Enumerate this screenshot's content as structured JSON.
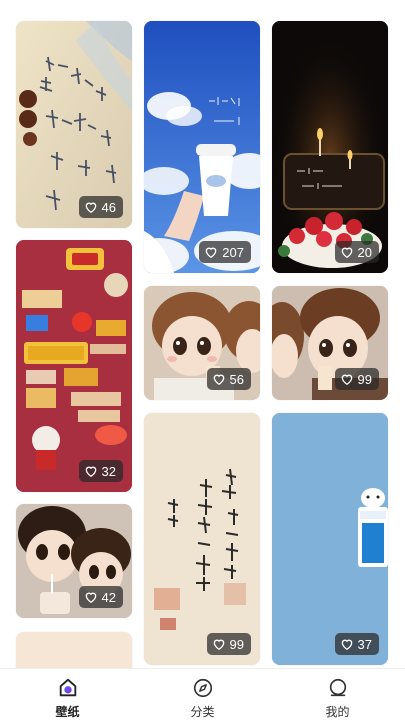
{
  "wallpapers": [
    {
      "likes": "46"
    },
    {
      "likes": "207"
    },
    {
      "likes": "20"
    },
    {
      "likes": "32"
    },
    {
      "likes": "56"
    },
    {
      "likes": "99"
    },
    {
      "likes": "42"
    },
    {
      "likes": "99"
    },
    {
      "likes": "37"
    }
  ],
  "tabbar": {
    "tabs": [
      {
        "label": "壁纸",
        "icon": "wallpaper-icon",
        "active": true
      },
      {
        "label": "分类",
        "icon": "compass-icon",
        "active": false
      },
      {
        "label": "我的",
        "icon": "profile-icon",
        "active": false
      }
    ]
  },
  "colors": {
    "accent": "#5a3fe0",
    "like_badge": "#282828",
    "card4": "#a83040",
    "card9": "#7fb0d8"
  }
}
